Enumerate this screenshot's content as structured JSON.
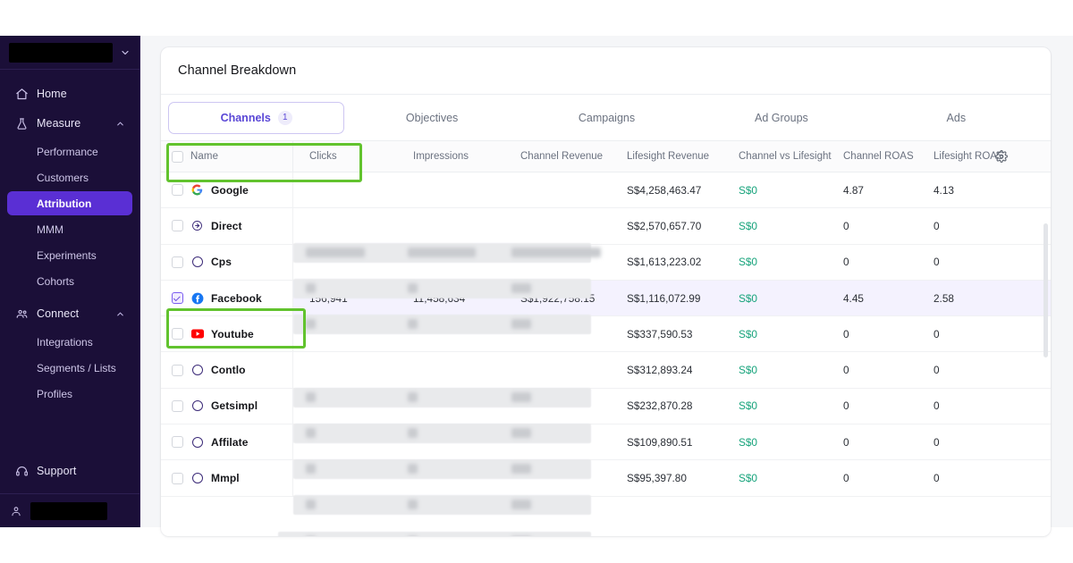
{
  "sidebar": {
    "workspace": {
      "name": "",
      "redacted": true,
      "chevron_icon": "chevron-down-icon"
    },
    "items": [
      {
        "label": "Home",
        "icon": "home-icon",
        "type": "top",
        "expanded": null
      },
      {
        "label": "Measure",
        "icon": "flask-icon",
        "type": "top",
        "expanded": true
      },
      {
        "label": "Performance",
        "type": "sub",
        "active": false
      },
      {
        "label": "Customers",
        "type": "sub",
        "active": false
      },
      {
        "label": "Attribution",
        "type": "sub",
        "active": true
      },
      {
        "label": "MMM",
        "type": "sub",
        "active": false
      },
      {
        "label": "Experiments",
        "type": "sub",
        "active": false
      },
      {
        "label": "Cohorts",
        "type": "sub",
        "active": false
      },
      {
        "label": "Connect",
        "icon": "people-icon",
        "type": "top",
        "expanded": true
      },
      {
        "label": "Integrations",
        "type": "sub",
        "active": false
      },
      {
        "label": "Segments / Lists",
        "type": "sub",
        "active": false
      },
      {
        "label": "Profiles",
        "type": "sub",
        "active": false
      }
    ],
    "support": {
      "label": "Support",
      "icon": "headset-icon"
    },
    "user": {
      "name": "",
      "redacted": true,
      "icon": "user-icon"
    }
  },
  "card": {
    "title": "Channel Breakdown",
    "tabs": [
      {
        "label": "Channels",
        "count": "1",
        "active": true,
        "annotated": true
      },
      {
        "label": "Objectives",
        "count": "",
        "active": false,
        "annotated": false
      },
      {
        "label": "Campaigns",
        "count": "",
        "active": false,
        "annotated": false
      },
      {
        "label": "Ad Groups",
        "count": "",
        "active": false,
        "annotated": false
      },
      {
        "label": "Ads",
        "count": "",
        "active": false,
        "annotated": false
      }
    ]
  },
  "table": {
    "columns": [
      "Name",
      "Clicks",
      "Impressions",
      "Channel Revenue",
      "Lifesight Revenue",
      "Channel vs Lifesight",
      "Channel ROAS",
      "Lifesight ROAS"
    ],
    "settings_icon": "gear-icon",
    "header_checkbox_checked": false,
    "rows": [
      {
        "name": "Google",
        "icon": "google-icon",
        "checked": false,
        "selected": false,
        "redacted": true,
        "clicks": "",
        "impressions": "",
        "channel_revenue": "",
        "lifesight_revenue": "S$4,258,463.47",
        "channel_vs_lifesight": "S$0",
        "channel_roas": "4.87",
        "lifesight_roas": "4.13"
      },
      {
        "name": "Direct",
        "icon": "direct-arrow-icon",
        "checked": false,
        "selected": false,
        "redacted": true,
        "clicks": "",
        "impressions": "",
        "channel_revenue": "",
        "lifesight_revenue": "S$2,570,657.70",
        "channel_vs_lifesight": "S$0",
        "channel_roas": "0",
        "lifesight_roas": "0"
      },
      {
        "name": "Cps",
        "icon": "circle-icon",
        "checked": false,
        "selected": false,
        "redacted": true,
        "clicks": "",
        "impressions": "",
        "channel_revenue": "",
        "lifesight_revenue": "S$1,613,223.02",
        "channel_vs_lifesight": "S$0",
        "channel_roas": "0",
        "lifesight_roas": "0"
      },
      {
        "name": "Facebook",
        "icon": "facebook-icon",
        "checked": true,
        "selected": true,
        "redacted": false,
        "clicks": "156,941",
        "impressions": "11,458,634",
        "channel_revenue": "S$1,922,758.15",
        "lifesight_revenue": "S$1,116,072.99",
        "channel_vs_lifesight": "S$0",
        "channel_roas": "4.45",
        "lifesight_roas": "2.58"
      },
      {
        "name": "Youtube",
        "icon": "youtube-icon",
        "checked": false,
        "selected": false,
        "redacted": true,
        "clicks": "",
        "impressions": "",
        "channel_revenue": "",
        "lifesight_revenue": "S$337,590.53",
        "channel_vs_lifesight": "S$0",
        "channel_roas": "0",
        "lifesight_roas": "0"
      },
      {
        "name": "Contlo",
        "icon": "circle-icon",
        "checked": false,
        "selected": false,
        "redacted": true,
        "clicks": "",
        "impressions": "",
        "channel_revenue": "",
        "lifesight_revenue": "S$312,893.24",
        "channel_vs_lifesight": "S$0",
        "channel_roas": "0",
        "lifesight_roas": "0"
      },
      {
        "name": "Getsimpl",
        "icon": "circle-icon",
        "checked": false,
        "selected": false,
        "redacted": true,
        "clicks": "",
        "impressions": "",
        "channel_revenue": "",
        "lifesight_revenue": "S$232,870.28",
        "channel_vs_lifesight": "S$0",
        "channel_roas": "0",
        "lifesight_roas": "0"
      },
      {
        "name": "Affilate",
        "icon": "circle-icon",
        "checked": false,
        "selected": false,
        "redacted": true,
        "clicks": "",
        "impressions": "",
        "channel_revenue": "",
        "lifesight_revenue": "S$109,890.51",
        "channel_vs_lifesight": "S$0",
        "channel_roas": "0",
        "lifesight_roas": "0"
      },
      {
        "name": "Mmpl",
        "icon": "circle-icon",
        "checked": false,
        "selected": false,
        "redacted": true,
        "clicks": "",
        "impressions": "",
        "channel_revenue": "",
        "lifesight_revenue": "S$95,397.80",
        "channel_vs_lifesight": "S$0",
        "channel_roas": "0",
        "lifesight_roas": "0"
      }
    ]
  },
  "colors": {
    "sidebar_bg": "#1b0f38",
    "sidebar_active": "#5a2fd4",
    "accent": "#5a47d6",
    "selected_row": "#f4f2fe",
    "positive_green": "#16a37b",
    "annotation_green": "#62c32e",
    "page_bg": "#f5f6f8"
  }
}
